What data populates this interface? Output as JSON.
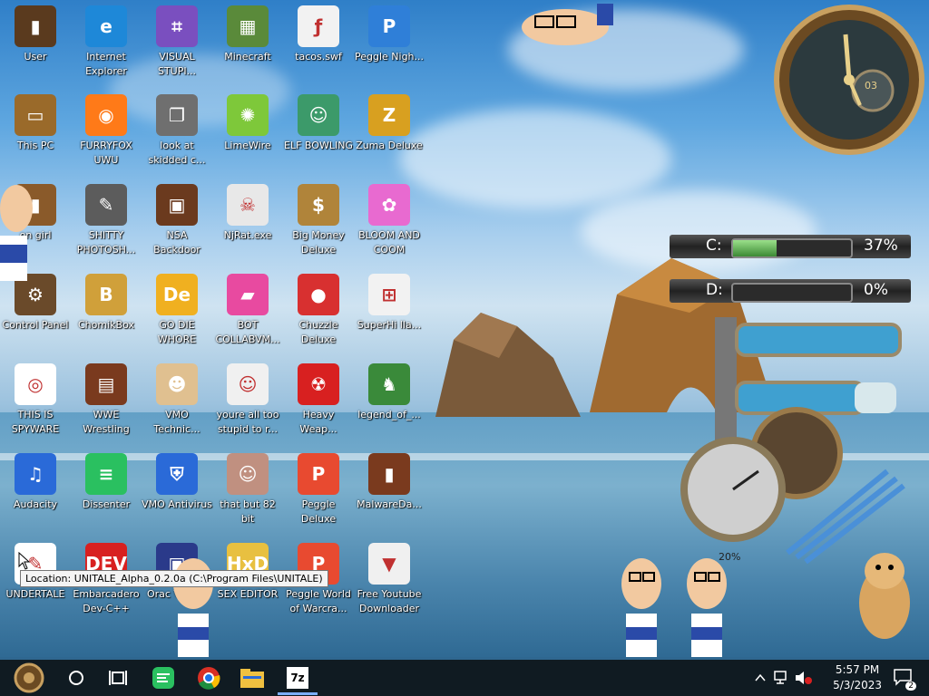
{
  "desktop": {
    "icons": [
      {
        "label": "User",
        "color": "#5a3a1e",
        "glyph": "▮"
      },
      {
        "label": "Internet Explorer",
        "color": "#1e88d8",
        "glyph": "e"
      },
      {
        "label": "VISUAL STUPI...",
        "color": "#7a4fbf",
        "glyph": "⌗"
      },
      {
        "label": "Minecraft",
        "color": "#5a8a3a",
        "glyph": "▦"
      },
      {
        "label": "tacos.swf",
        "color": "#f2f2f2",
        "glyph": "ƒ"
      },
      {
        "label": "Peggle Nigh...",
        "color": "#2f7fd8",
        "glyph": "P"
      },
      {
        "label": "This PC",
        "color": "#9a6a2a",
        "glyph": "▭"
      },
      {
        "label": "FURRYFOX UWU",
        "color": "#ff7a18",
        "glyph": "◉"
      },
      {
        "label": "look at skidded c...",
        "color": "#6f6f6f",
        "glyph": "❐"
      },
      {
        "label": "LimeWire",
        "color": "#7ec83a",
        "glyph": "✺"
      },
      {
        "label": "ELF BOWLING",
        "color": "#3c9a6a",
        "glyph": "☺"
      },
      {
        "label": "Zuma Deluxe",
        "color": "#d8a020",
        "glyph": "Z"
      },
      {
        "label": "on girl",
        "color": "#8a5a2a",
        "glyph": "▮"
      },
      {
        "label": "SHITTY PHOTOSH...",
        "color": "#5c5c5c",
        "glyph": "✎"
      },
      {
        "label": "NSA Backdoor",
        "color": "#6b3a1e",
        "glyph": "▣"
      },
      {
        "label": "NjRat.exe",
        "color": "#e8e8e8",
        "glyph": "☠"
      },
      {
        "label": "Big Money Deluxe",
        "color": "#b0843a",
        "glyph": "$"
      },
      {
        "label": "BLOOM AND COOM",
        "color": "#e86ad0",
        "glyph": "✿"
      },
      {
        "label": "Control Panel",
        "color": "#6a4a2a",
        "glyph": "⚙"
      },
      {
        "label": "ChomikBox",
        "color": "#d0a03a",
        "glyph": "B"
      },
      {
        "label": "GO DIE WHORE",
        "color": "#f0b020",
        "glyph": "De"
      },
      {
        "label": "BOT COLLABVM...",
        "color": "#e84aa0",
        "glyph": "▰"
      },
      {
        "label": "Chuzzle Deluxe",
        "color": "#d83030",
        "glyph": "●"
      },
      {
        "label": "SuperHi lla...",
        "color": "#f2f2f2",
        "glyph": "⊞"
      },
      {
        "label": "THIS IS SPYWARE",
        "color": "#ffffff",
        "glyph": "◎"
      },
      {
        "label": "WWE Wrestling",
        "color": "#7a3a1e",
        "glyph": "▤"
      },
      {
        "label": "VMO Technic...",
        "color": "#e0c090",
        "glyph": "☻"
      },
      {
        "label": "youre all too stupid to r...",
        "color": "#f0f0f0",
        "glyph": "☺"
      },
      {
        "label": "Heavy Weap...",
        "color": "#d82020",
        "glyph": "☢"
      },
      {
        "label": "legend_of_...",
        "color": "#3a8a3a",
        "glyph": "♞"
      },
      {
        "label": "Audacity",
        "color": "#2a6ad8",
        "glyph": "♫"
      },
      {
        "label": "Dissenter",
        "color": "#2ac060",
        "glyph": "≡"
      },
      {
        "label": "VMO Antivirus",
        "color": "#2a6ad8",
        "glyph": "⛨"
      },
      {
        "label": "that but 82 bit",
        "color": "#c09080",
        "glyph": "☺"
      },
      {
        "label": "Peggle Deluxe",
        "color": "#e84a30",
        "glyph": "P"
      },
      {
        "label": "MalwareDa...",
        "color": "#7a3a1e",
        "glyph": "▮"
      },
      {
        "label": "UNDERTALE",
        "color": "#ffffff",
        "glyph": "✎"
      },
      {
        "label": "Embarcadero Dev-C++",
        "color": "#d82020",
        "glyph": "DEV"
      },
      {
        "label": "Orac Virtu...",
        "color": "#2a3a8a",
        "glyph": "▣"
      },
      {
        "label": "SEX EDITOR",
        "color": "#e8c040",
        "glyph": "HxD"
      },
      {
        "label": "Peggle World of Warcra...",
        "color": "#e84a30",
        "glyph": "P"
      },
      {
        "label": "Free Youtube Downloader",
        "color": "#f0f0f0",
        "glyph": "▼"
      }
    ]
  },
  "tooltip": {
    "text": "Location: UNITALE_Alpha_0.2.0a (C:\\Program Files\\UNITALE)"
  },
  "widgets": {
    "clock": {
      "center_number": "03"
    },
    "drives": [
      {
        "letter": "C:",
        "percent": "37%",
        "fill_fraction": 0.37
      },
      {
        "letter": "D:",
        "percent": "0%",
        "fill_fraction": 0.0
      }
    ],
    "meter": {
      "label": "20%"
    }
  },
  "taskbar": {
    "items": [
      "start-icon",
      "search-icon",
      "task-view-icon",
      "dissenter-icon",
      "chrome-icon",
      "file-explorer-icon",
      "7zip-icon"
    ],
    "zip_label": "7z",
    "time": "5:57 PM",
    "date": "5/3/2023",
    "notification_count": "2"
  }
}
